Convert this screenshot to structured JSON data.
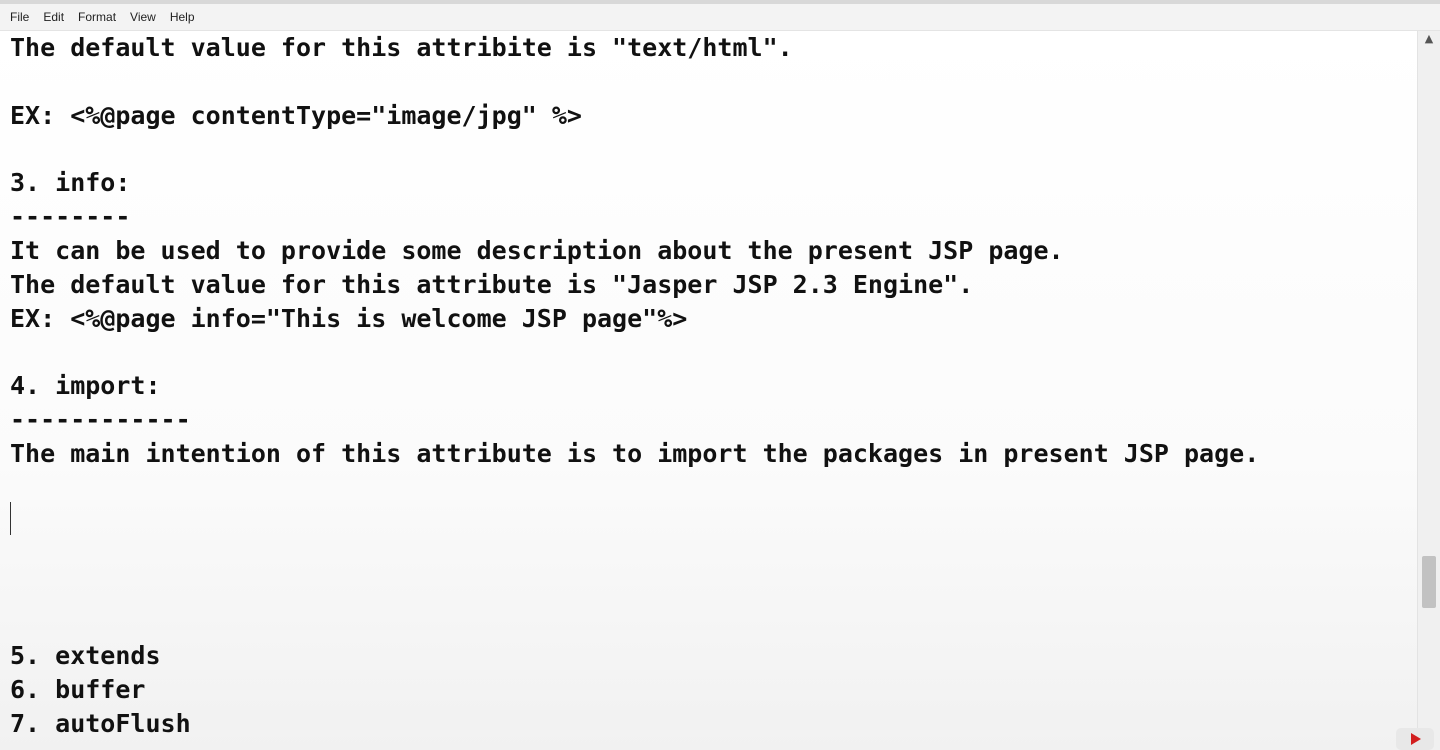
{
  "menu": [
    "File",
    "Edit",
    "Format",
    "View",
    "Help"
  ],
  "editor": {
    "lines": [
      "The default value for this attribite is \"text/html\".",
      "",
      "EX: <%@page contentType=\"image/jpg\" %>",
      "",
      "3. info:",
      "--------",
      "It can be used to provide some description about the present JSP page.",
      "The default value for this attribute is \"Jasper JSP 2.3 Engine\".",
      "EX: <%@page info=\"This is welcome JSP page\"%>",
      "",
      "4. import:",
      "------------",
      "The main intention of this attribute is to import the packages in present JSP page.",
      "",
      "",
      "",
      "",
      "",
      "5. extends",
      "6. buffer",
      "7. autoFlush"
    ]
  },
  "icons": {
    "scroll_up": "chevron-up-icon",
    "scroll_down": "chevron-down-icon",
    "youtube": "youtube-logo-icon"
  }
}
